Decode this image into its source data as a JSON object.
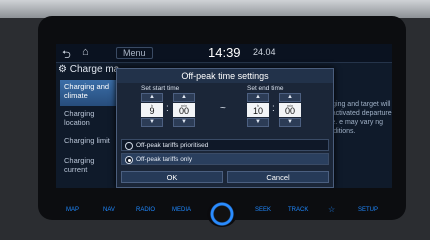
{
  "status_bar": {
    "menu_label": "Menu",
    "time": "14:39",
    "date": "24.04"
  },
  "page": {
    "title": "Charge ma"
  },
  "sidebar": {
    "items": [
      {
        "label": "Charging and climate"
      },
      {
        "label": "Charging location"
      },
      {
        "label": "Charging limit"
      },
      {
        "label": "Charging current"
      }
    ]
  },
  "background_text": "harging and target will be activated departure time. e may vary ng conditions.",
  "dialog": {
    "title": "Off-peak time settings",
    "start": {
      "label": "Set start time",
      "h_unit": "h",
      "hours": "9",
      "m_unit": "min",
      "minutes": "00"
    },
    "end": {
      "label": "Set end time",
      "h_unit": "h",
      "hours": "10",
      "m_unit": "min",
      "minutes": "00"
    },
    "separator": "~",
    "options": [
      {
        "label": "Off-peak tariffs prioritised",
        "selected": false
      },
      {
        "label": "Off-peak tariffs only",
        "selected": true
      }
    ],
    "ok_label": "OK",
    "cancel_label": "Cancel"
  },
  "hardware_buttons": [
    "MAP",
    "NAV",
    "RADIO",
    "MEDIA",
    "SEEK",
    "TRACK",
    "SETUP"
  ]
}
